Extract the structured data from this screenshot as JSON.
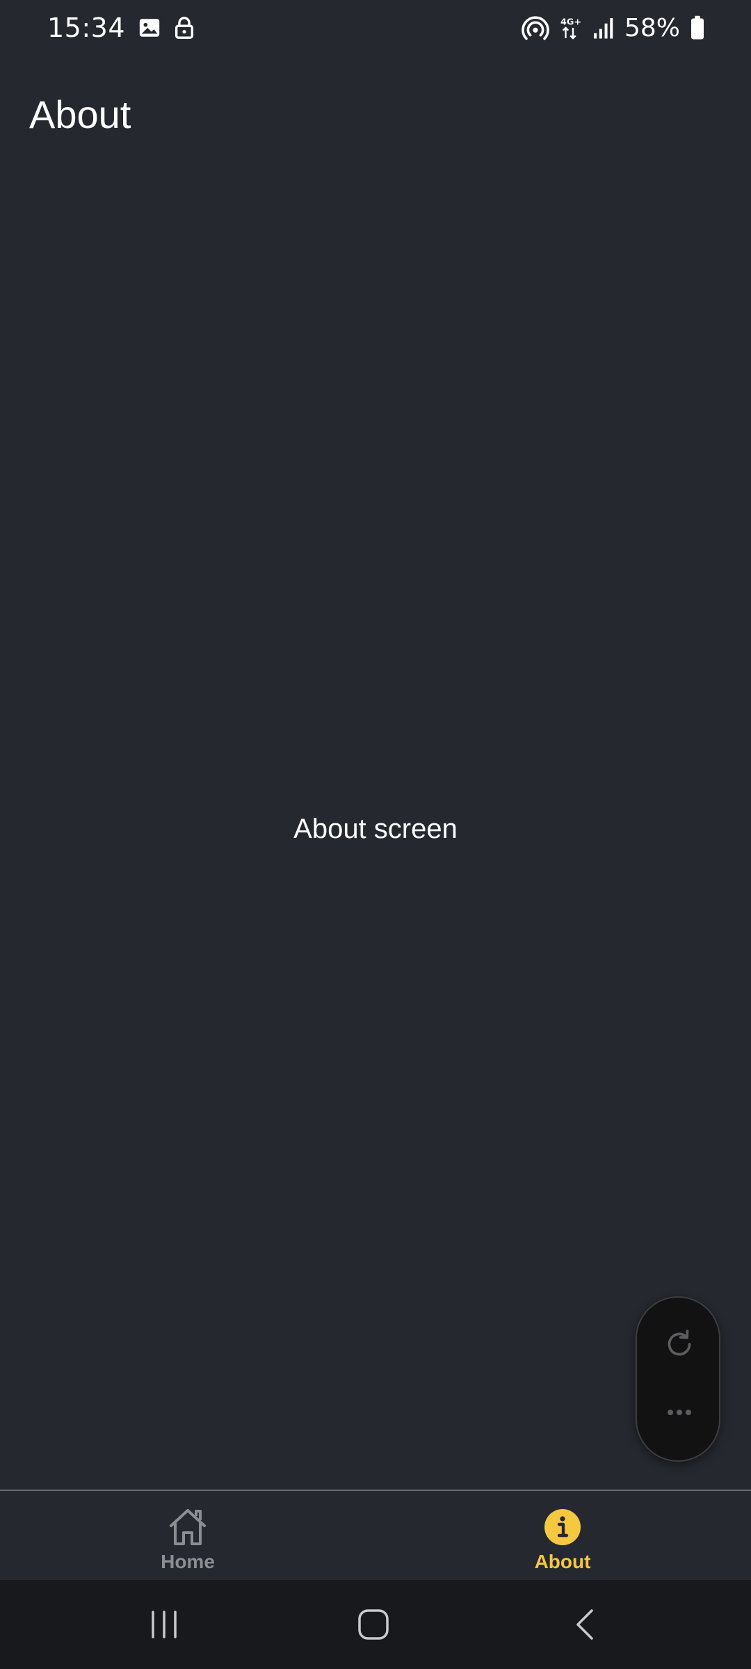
{
  "status_bar": {
    "time": "15:34",
    "battery_percent": "58%",
    "network": "4G+",
    "left_icons": [
      "image-icon",
      "lock-icon"
    ],
    "right_icons": [
      "hotspot-icon",
      "network-4g-icon",
      "signal-icon",
      "battery-icon"
    ]
  },
  "header": {
    "title": "About"
  },
  "content": {
    "text": "About screen"
  },
  "floating_panel": {
    "icons": [
      "refresh-icon",
      "more-icon"
    ]
  },
  "tabs": [
    {
      "label": "Home",
      "icon": "home-icon",
      "selected": false
    },
    {
      "label": "About",
      "icon": "info-icon",
      "selected": true
    }
  ],
  "nav_bar": {
    "icons": [
      "recents-icon",
      "home-button-icon",
      "back-icon"
    ]
  },
  "colors": {
    "background": "#25282e",
    "accent": "#f5c842",
    "tab_inactive": "#8c8e92",
    "nav_bar": "#17191d"
  }
}
